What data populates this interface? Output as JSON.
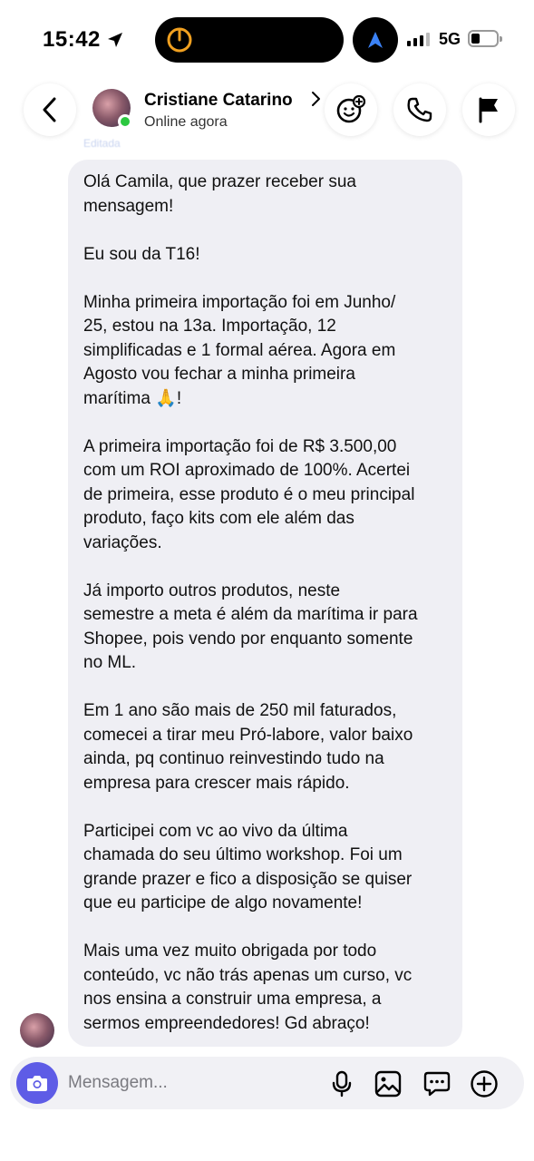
{
  "status_bar": {
    "time": "15:42",
    "network": "5G"
  },
  "header": {
    "contact_name": "Cristiane Catarino",
    "contact_status": "Online agora",
    "online_color": "#2bc840"
  },
  "thread": {
    "edited_label": "Editada",
    "message_paragraphs": [
      "Olá Camila, que prazer receber sua\nmensagem!",
      "Eu sou da T16!",
      "Minha primeira importação foi em Junho/\n25, estou na 13a. Importação, 12\nsimplificadas e 1 formal aérea. Agora em\nAgosto vou fechar a minha primeira\nmarítima 🙏!",
      "A primeira importação foi de R$ 3.500,00\ncom um ROI aproximado de 100%. Acertei\nde primeira, esse produto é o meu principal\nproduto, faço kits com ele além das\nvariações.",
      "Já importo outros produtos, neste\nsemestre a meta é além da marítima ir para\nShopee, pois vendo por enquanto somente\nno ML.",
      "Em 1 ano são mais de 250 mil faturados,\ncomecei a tirar meu Pró-labore, valor baixo\nainda, pq continuo reinvestindo tudo na\nempresa para crescer mais rápido.",
      "Participei com vc ao vivo da última\nchamada do seu último workshop. Foi um\ngrande prazer e fico a disposição se quiser\nque eu participe de algo novamente!",
      "Mais uma vez muito obrigada por todo\nconteúdo, vc não trás apenas um curso, vc\nnos ensina a construir uma empresa, a\nsermos empreendedores! Gd abraço!"
    ]
  },
  "composer": {
    "placeholder": "Mensagem...",
    "accent_color": "#5e5ce6"
  }
}
